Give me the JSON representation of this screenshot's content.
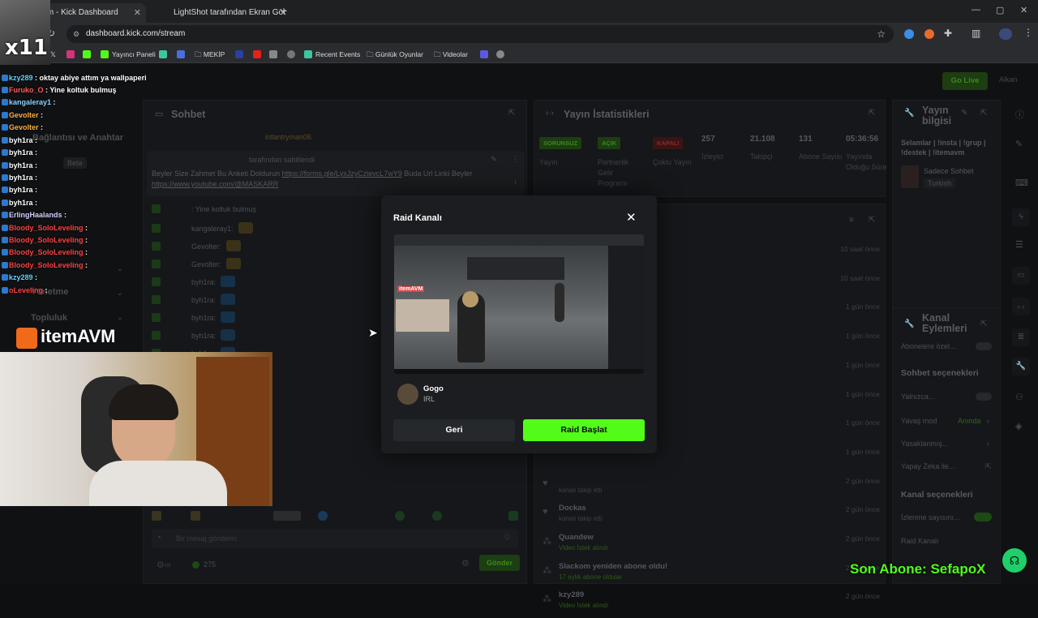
{
  "browser": {
    "tabs": [
      {
        "label": "Stream - Kick Dashboard"
      },
      {
        "label": "LightShot tarafından Ekran Gör"
      }
    ],
    "url": "dashboard.kick.com/stream",
    "bookmarks": [
      "Yayıncı Paneli",
      "MEKİP",
      "Recent Events",
      "Günlük Oyunlar",
      "Videolar"
    ]
  },
  "overlay": {
    "x11": "x11",
    "brand_logo": "itemAVM",
    "sub_banner": "Son Abone: SefapoX",
    "chat": [
      {
        "user": "kzy289",
        "msg": "oktay abiye attım ya wallpaperi",
        "color": "#5bd3ff"
      },
      {
        "user": "Furuko_O",
        "msg": "Yine koltuk bulmuş",
        "color": "#ff5a5a"
      },
      {
        "user": "kangaleray1",
        "msg": "",
        "color": "#8ad4ff"
      },
      {
        "user": "Gevolter",
        "msg": "",
        "color": "#ffb03a"
      },
      {
        "user": "Gevolter",
        "msg": "",
        "color": "#ffb03a"
      },
      {
        "user": "byh1ra",
        "msg": "",
        "color": "#ffffff"
      },
      {
        "user": "byh1ra",
        "msg": "",
        "color": "#ffffff"
      },
      {
        "user": "byh1ra",
        "msg": "",
        "color": "#ffffff"
      },
      {
        "user": "byh1ra",
        "msg": "",
        "color": "#ffffff"
      },
      {
        "user": "byh1ra",
        "msg": "",
        "color": "#ffffff"
      },
      {
        "user": "byh1ra",
        "msg": "",
        "color": "#ffffff"
      },
      {
        "user": "ErlingHaalands",
        "msg": "",
        "color": "#d0d0ff"
      },
      {
        "user": "Bloody_SoloLeveling",
        "msg": "",
        "color": "#ff4040"
      },
      {
        "user": "Bloody_SoloLeveling",
        "msg": "",
        "color": "#ff4040"
      },
      {
        "user": "Bloody_SoloLeveling",
        "msg": "",
        "color": "#ff4040"
      },
      {
        "user": "Bloody_SoloLeveling",
        "msg": "",
        "color": "#ff4040"
      },
      {
        "user": "kzy289",
        "msg": "",
        "color": "#5bd3ff"
      },
      {
        "user": "oLeveling",
        "msg": "",
        "color": "#ff4040"
      }
    ]
  },
  "dashboard": {
    "go_live": "Go Live",
    "sidebar": {
      "baglantisi": "Bağlantısı ve Anahtar",
      "beta": "Beta",
      "yonetme": "Yönetme",
      "topluluk": "Topluluk"
    },
    "chat_panel": {
      "title": "Sohbet",
      "pinned_by": "tarafından sabitlendi",
      "pinned_msg": "Beyler Size Zahmet Bu Anketi Doldurun",
      "pinned_link": "https://forms.gle/LyxJzyCzievcL7wY9",
      "pinned_msg2": "Buda Url Linki Beyler",
      "pinned_link2": "https://www.youtube.com/@MASKARR",
      "top_user": "infantryman06",
      "msgs": [
        {
          "user": "",
          "text": ": Yine koltuk bulmuş"
        },
        {
          "user": "kangaleray1:",
          "text": ""
        },
        {
          "user": "Gevolter:",
          "text": ""
        },
        {
          "user": "Gevolter:",
          "text": ""
        },
        {
          "user": "byh1ra:",
          "text": ""
        },
        {
          "user": "byh1ra:",
          "text": ""
        },
        {
          "user": "byh1ra:",
          "text": ""
        },
        {
          "user": "byh1ra:",
          "text": ""
        },
        {
          "user": "byh1ra:",
          "text": ""
        }
      ],
      "input_placeholder": "Bir mesaj gönderin",
      "viewer_count": "275",
      "send": "Gönder"
    },
    "stats": {
      "title": "Yayın İstatistikleri",
      "items": [
        {
          "badge": "SORUNSUZ",
          "label": "Yayın"
        },
        {
          "badge": "AÇIK",
          "label": "Partnerlik Gelir Programı"
        },
        {
          "badge": "KAPALI",
          "label": "Çoklu Yayın"
        },
        {
          "value": "257",
          "label": "İzleyici"
        },
        {
          "value": "21.108",
          "label": "Takipçi"
        },
        {
          "value": "131",
          "label": "Abone Sayısı"
        },
        {
          "value": "05:36:56",
          "label": "Yayında Olduğu Süre"
        }
      ]
    },
    "activity": [
      {
        "time": "10 saat önce"
      },
      {
        "time": "10 saat önce"
      },
      {
        "time": "1 gün önce"
      },
      {
        "time": "1 gün önce"
      },
      {
        "time": "1 gün önce"
      },
      {
        "time": "1 gün önce"
      },
      {
        "time": "1 gün önce"
      },
      {
        "time": "1 gün önce"
      },
      {
        "time": "2 gün önce",
        "name": "",
        "sub": "kanalı takip etti"
      },
      {
        "time": "2 gün önce",
        "name": "Dockas",
        "sub": "kanalı takip etti"
      },
      {
        "time": "2 gün önce",
        "name": "Quandew",
        "sub": "Video İstek alındı"
      },
      {
        "time": "2 gün önce",
        "name": "Slackom yeniden abone oldu!",
        "sub": "17 aylık abone oldular"
      },
      {
        "time": "2 gün önce",
        "name": "kzy289",
        "sub": "Video İstek alındı"
      }
    ],
    "info": {
      "title": "Yayın bilgisi",
      "desc": "Selamlar | !insta | !grup | !destek | !itemavm",
      "category": "Sadece Sohbet",
      "lang": "Turkish"
    },
    "channel_actions": {
      "title": "Kanal Eylemleri",
      "subs_only": "Abonelere özel...",
      "chat_options": "Sohbet seçenekleri",
      "only": "Yalnızca...",
      "slow": "Yavaş mod",
      "slow_value": "Anında",
      "banned": "Yasaklanmış...",
      "ai": "Yapay Zeka ile...",
      "channel_options": "Kanal seçenekleri",
      "viewer_count": "İzlenme sayısını...",
      "raid": "Raid Kanalı"
    }
  },
  "modal": {
    "title": "Raid Kanalı",
    "channel_name": "Gogo",
    "category": "IRL",
    "back": "Geri",
    "start": "Raid Başlat",
    "preview_logo": "itemAVM"
  }
}
